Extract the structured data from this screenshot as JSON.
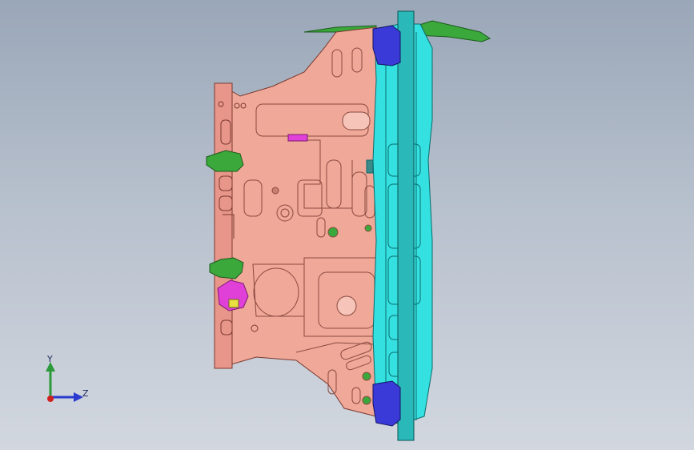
{
  "viewport": {
    "background": "#b4bdca"
  },
  "model": {
    "panel_color": "#f0a898",
    "panel_edge": "#7a3a30",
    "frame_color": "#35e0e0",
    "frame_edge": "#0a6b6b",
    "bracket_color": "#3a3ad8",
    "clip_color": "#3aa83a",
    "connector_color": "#e040d8"
  },
  "triad": {
    "y_label": "Y",
    "z_label": "Z",
    "y_color": "#2a9a3a",
    "z_color": "#2a3ad0",
    "x_color": "#d02020"
  }
}
